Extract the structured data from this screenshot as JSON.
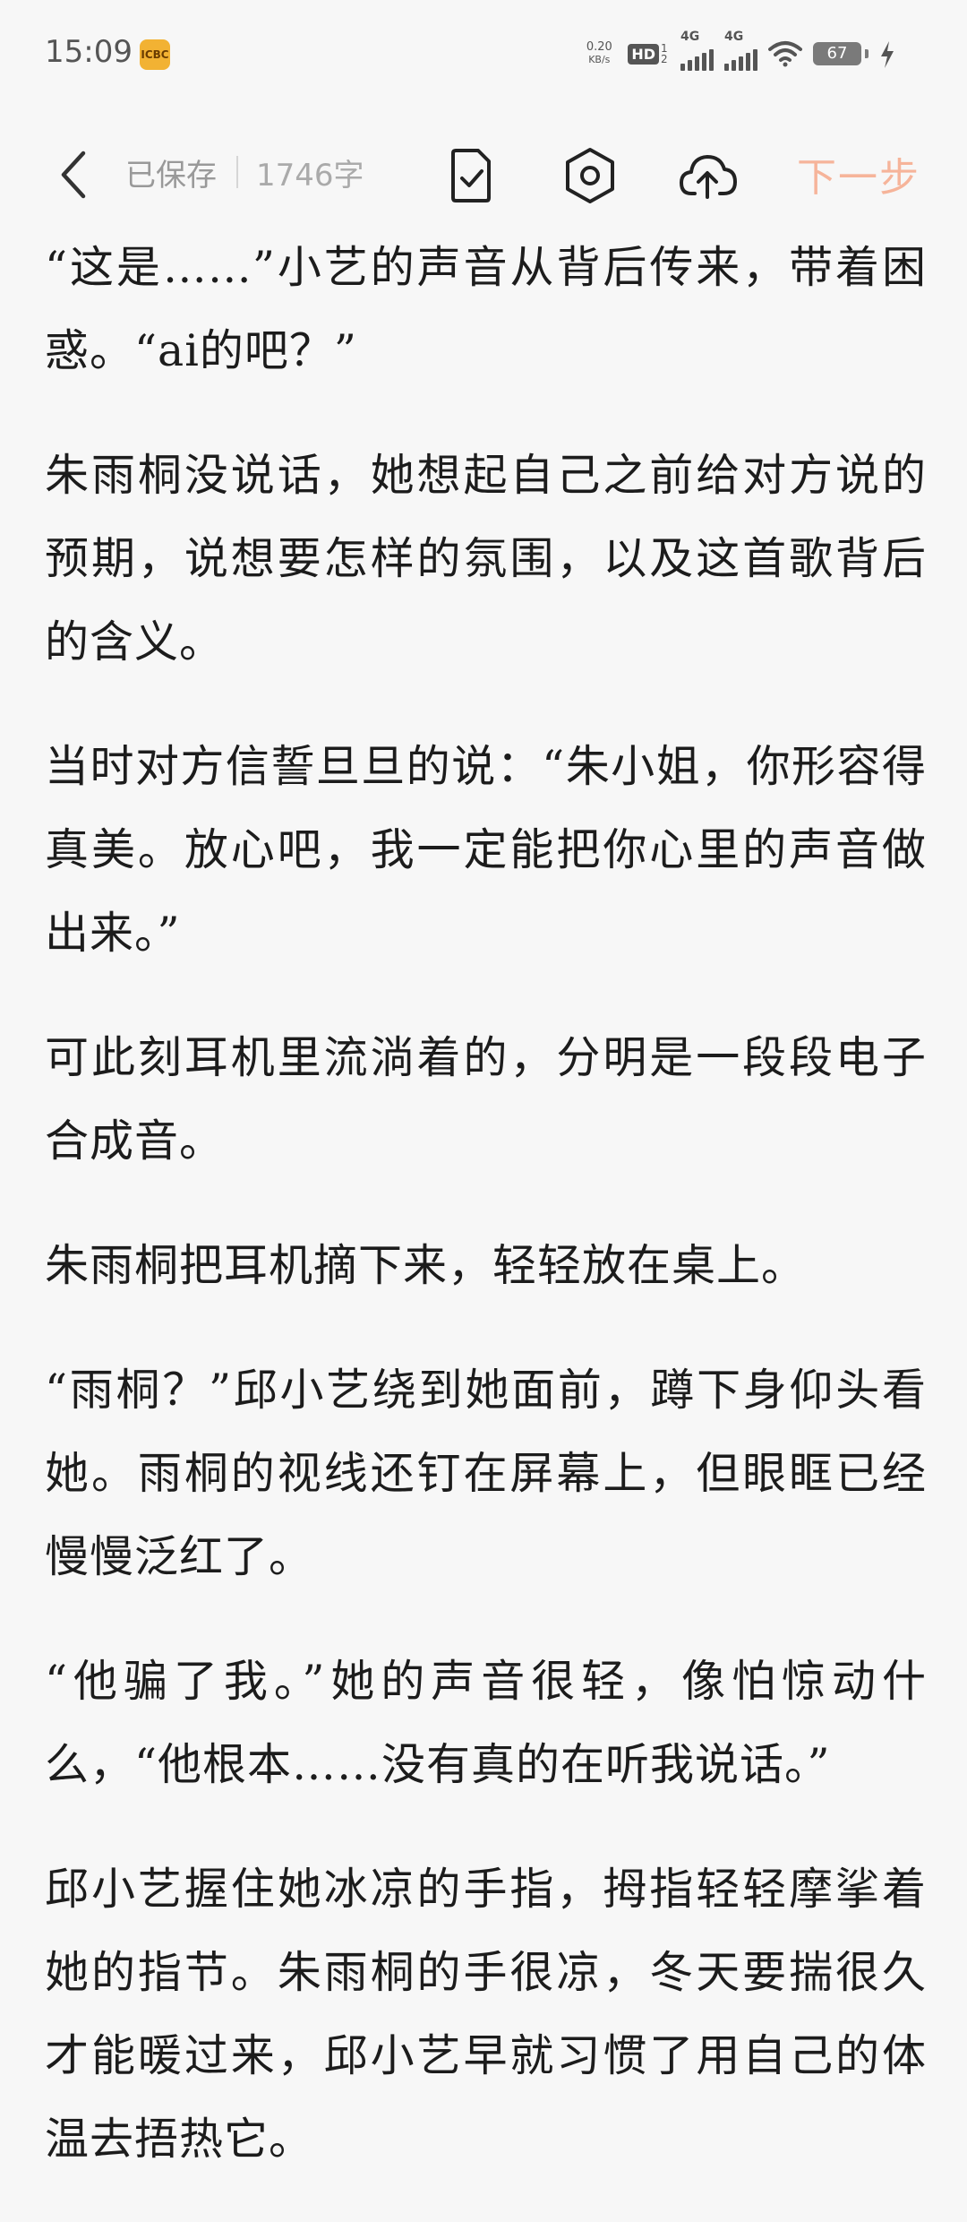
{
  "status_bar": {
    "time": "15:09",
    "network_speed_value": "0.20",
    "network_speed_unit": "KB/s",
    "hd_label": "HD",
    "hd_sims": "12",
    "signal1_label": "4G",
    "signal2_label": "4G",
    "battery_level": "67",
    "app_icon_label": "ICBC",
    "icons": [
      "app-notification-icon",
      "hd-icon",
      "signal-icon",
      "signal-icon",
      "wifi-icon",
      "battery-icon",
      "charging-bolt-icon"
    ]
  },
  "toolbar": {
    "saved_label": "已保存",
    "word_count": "1746字",
    "next_label": "下一步",
    "icons": [
      "back-arrow-icon",
      "document-check-icon",
      "settings-hexagon-icon",
      "cloud-upload-icon"
    ],
    "accent_color": "#f6b49a"
  },
  "content": {
    "paragraphs": [
      "“这是……”小艺的声音从背后传来，带着困惑。“ai的吧？”",
      "朱雨桐没说话，她想起自己之前给对方说的预期，说想要怎样的氛围，以及这首歌背后的含义。",
      "当时对方信誓旦旦的说：“朱小姐，你形容得真美。放心吧，我一定能把你心里的声音做出来。”",
      "可此刻耳机里流淌着的，分明是一段段电子合成音。",
      "朱雨桐把耳机摘下来，轻轻放在桌上。",
      "“雨桐？”邱小艺绕到她面前，蹲下身仰头看她。雨桐的视线还钉在屏幕上，但眼眶已经慢慢泛红了。",
      "“他骗了我。”她的声音很轻，像怕惊动什么，“他根本……没有真的在听我说话。”",
      "邱小艺握住她冰凉的手指，拇指轻轻摩挲着她的指节。朱雨桐的手很凉，冬天要揣很久才能暖过来，邱小艺早就习惯了用自己的体温去捂热它。"
    ]
  }
}
